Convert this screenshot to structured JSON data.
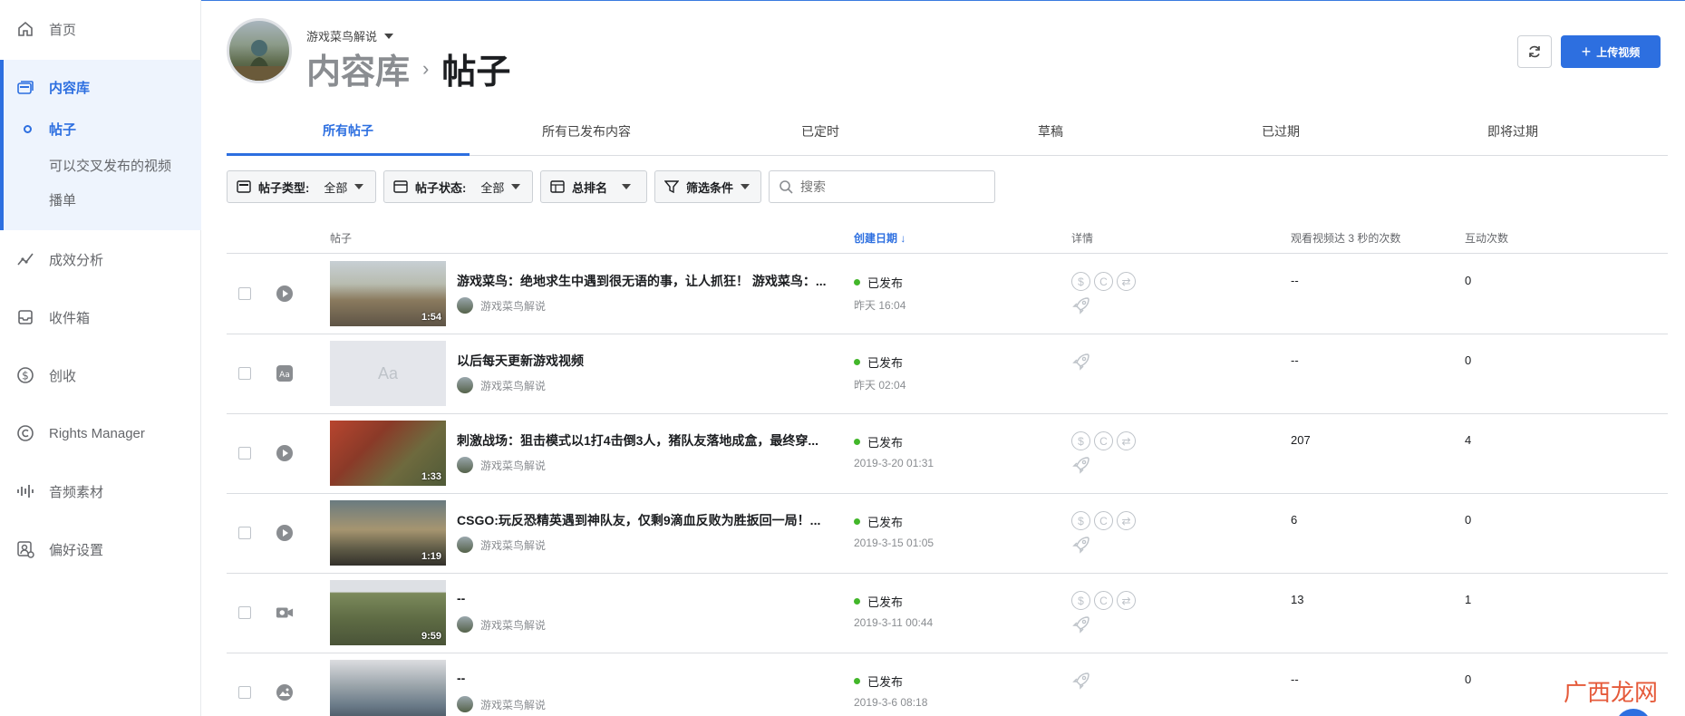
{
  "sidebar": {
    "home": "首页",
    "content_library": "内容库",
    "posts": "帖子",
    "crosspost": "可以交叉发布的视频",
    "playlists": "播单",
    "insights": "成效分析",
    "inbox": "收件箱",
    "monetization": "创收",
    "rights_manager": "Rights Manager",
    "sound_collection": "音频素材",
    "settings": "偏好设置"
  },
  "header": {
    "page_name": "游戏菜鸟解说",
    "breadcrumb_parent": "内容库",
    "breadcrumb_current": "帖子",
    "upload_label": "上传视频"
  },
  "tabs": [
    "所有帖子",
    "所有已发布内容",
    "已定时",
    "草稿",
    "已过期",
    "即将过期"
  ],
  "filters": {
    "post_type_label": "帖子类型:",
    "post_type_value": "全部",
    "post_status_label": "帖子状态:",
    "post_status_value": "全部",
    "ranking_label": "总排名",
    "conditions_label": "筛选条件",
    "search_placeholder": "搜索"
  },
  "table": {
    "headers": {
      "post": "帖子",
      "created": "创建日期",
      "details": "详情",
      "views": "观看视频达 3 秒的次数",
      "interactions": "互动次数"
    },
    "rows": [
      {
        "type": "video",
        "title": "游戏菜鸟：绝地求生中遇到很无语的事，让人抓狂！ 游戏菜鸟：...",
        "author": "游戏菜鸟解说",
        "duration": "1:54",
        "status": "已发布",
        "date": "昨天 16:04",
        "views": "--",
        "interactions": "0",
        "badges": true
      },
      {
        "type": "text",
        "title": "以后每天更新游戏视频",
        "author": "游戏菜鸟解说",
        "duration": "",
        "thumb_text": "Aa",
        "status": "已发布",
        "date": "昨天 02:04",
        "views": "--",
        "interactions": "0",
        "badges": false
      },
      {
        "type": "video",
        "title": "刺激战场：狙击模式以1打4击倒3人，猪队友落地成盒，最终穿...",
        "author": "游戏菜鸟解说",
        "duration": "1:33",
        "status": "已发布",
        "date": "2019-3-20 01:31",
        "views": "207",
        "interactions": "4",
        "badges": true
      },
      {
        "type": "video",
        "title": "CSGO:玩反恐精英遇到神队友，仅剩9滴血反败为胜扳回一局！...",
        "author": "游戏菜鸟解说",
        "duration": "1:19",
        "status": "已发布",
        "date": "2019-3-15 01:05",
        "views": "6",
        "interactions": "0",
        "badges": true
      },
      {
        "type": "live",
        "title": "--",
        "author": "游戏菜鸟解说",
        "duration": "9:59",
        "status": "已发布",
        "date": "2019-3-11 00:44",
        "views": "13",
        "interactions": "1",
        "badges": true
      },
      {
        "type": "photo",
        "title": "--",
        "author": "游戏菜鸟解说",
        "duration": "",
        "status": "已发布",
        "date": "2019-3-6 08:18",
        "views": "--",
        "interactions": "0",
        "badges": false
      }
    ]
  },
  "watermark": "广西龙网"
}
